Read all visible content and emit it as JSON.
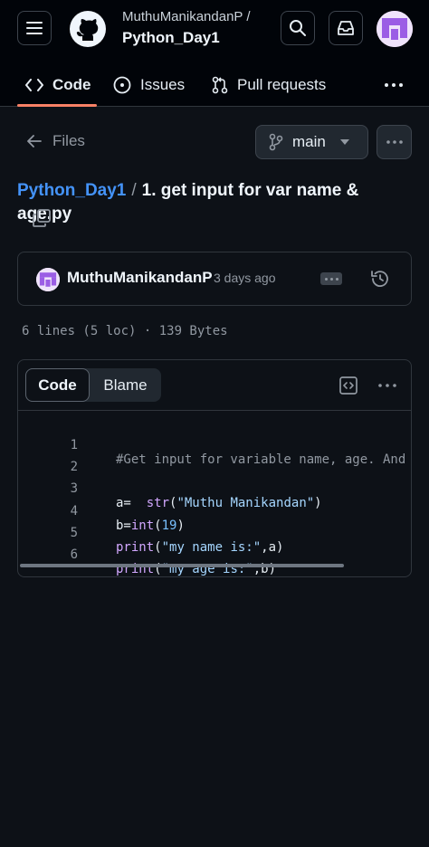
{
  "header": {
    "owner": "MuthuManikandanP /",
    "repo": "Python_Day1"
  },
  "tabs": [
    {
      "label": "Code"
    },
    {
      "label": "Issues"
    },
    {
      "label": "Pull requests"
    }
  ],
  "toolbar": {
    "files_label": "Files",
    "branch": "main"
  },
  "breadcrumb": {
    "repo": "Python_Day1",
    "separator": "/",
    "file": "1. get input for var name & age.py"
  },
  "commit": {
    "author": "MuthuManikandanP",
    "time": "3 days ago"
  },
  "file_info": "6 lines (5 loc) · 139 Bytes",
  "viewer": {
    "code_tab": "Code",
    "blame_tab": "Blame"
  },
  "code": {
    "line_numbers": [
      "1",
      "2",
      "3",
      "4",
      "5",
      "6"
    ],
    "l1": "#Get input for variable name, age. And",
    "l3_a": "a=  ",
    "l3_fn": "str",
    "l3_p1": "(",
    "l3_s": "\"Muthu Manikandan\"",
    "l3_p2": ")",
    "l4_a": "b=",
    "l4_fn": "int",
    "l4_p1": "(",
    "l4_n": "19",
    "l4_p2": ")",
    "l5_fn": "print",
    "l5_p1": "(",
    "l5_s": "\"my name is:\"",
    "l5_rest": ",a)",
    "l6_fn": "print",
    "l6_p1": "(",
    "l6_s": "\"my age is:\"",
    "l6_rest": ",b)"
  }
}
